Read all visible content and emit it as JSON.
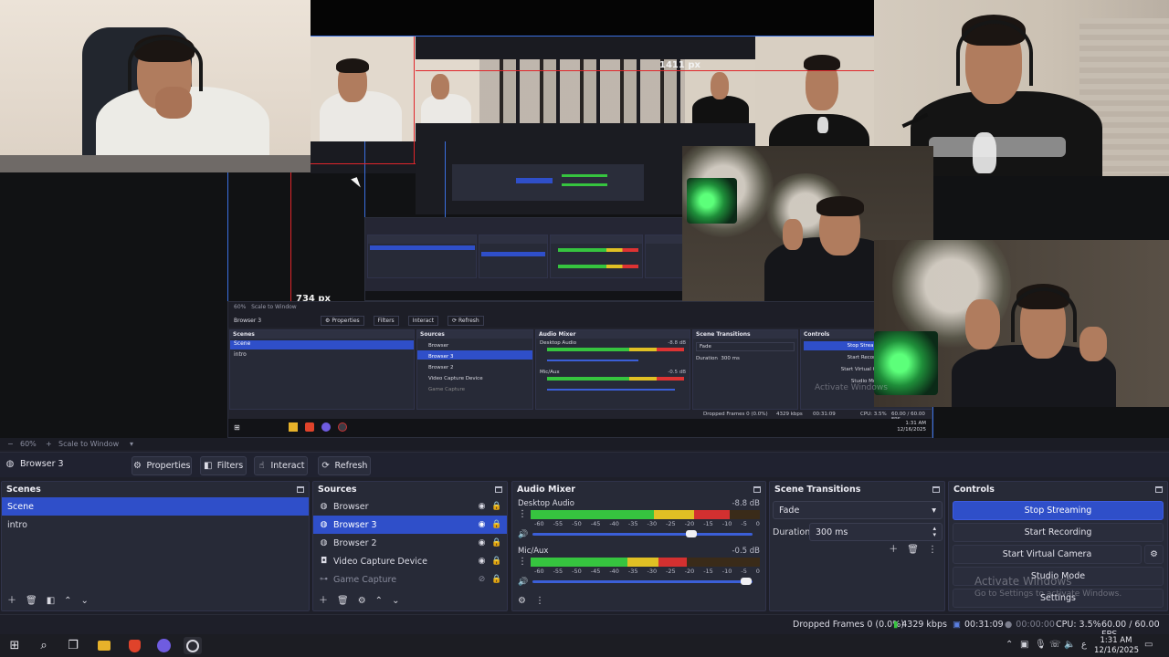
{
  "preview": {
    "labels": {
      "h_px": "1411 px",
      "v_px": "734 px"
    },
    "nested_window": {
      "zoom": "60%",
      "scale_label": "Scale to Window",
      "source": "Browser 3",
      "buttons": [
        "Properties",
        "Filters",
        "Interact",
        "Refresh"
      ],
      "docks": [
        "Scenes",
        "Sources",
        "Audio Mixer",
        "Scene Transitions",
        "Controls"
      ],
      "scenes": [
        "Scene",
        "intro"
      ],
      "sources": [
        "Browser",
        "Browser 3",
        "Browser 2",
        "Video Capture Device",
        "Game Capture"
      ],
      "mixer": [
        {
          "name": "Desktop Audio",
          "db": "-8.8 dB"
        },
        {
          "name": "Mic/Aux",
          "db": "-0.5 dB"
        }
      ],
      "transition": "Fade",
      "duration_label": "Duration",
      "duration": "300 ms",
      "controls": [
        "Stop Streaming",
        "Start Recording",
        "Start Virtual Camera",
        "Studio Mode"
      ],
      "status": [
        "Dropped Frames 0 (0.0%)",
        "4329 kbps",
        "00:31:09",
        "CPU: 3.5%",
        "60.00 / 60.00 FPS"
      ],
      "clock": [
        "1:31 AM",
        "12/16/2025"
      ]
    }
  },
  "zoombar": {
    "zoom": "60%",
    "scale": "Scale to Window"
  },
  "context": {
    "source_name": "Browser 3",
    "properties": "Properties",
    "filters": "Filters",
    "interact": "Interact",
    "refresh": "Refresh"
  },
  "scenes": {
    "title": "Scenes",
    "items": [
      "Scene",
      "intro"
    ],
    "selected": 0
  },
  "sources": {
    "title": "Sources",
    "items": [
      {
        "name": "Browser",
        "type": "globe-icon"
      },
      {
        "name": "Browser 3",
        "type": "globe-icon"
      },
      {
        "name": "Browser 2",
        "type": "globe-icon"
      },
      {
        "name": "Video Capture Device",
        "type": "camera-icon"
      },
      {
        "name": "Game Capture",
        "type": "gamepad-icon"
      }
    ],
    "selected": 1
  },
  "mixer": {
    "title": "Audio Mixer",
    "ticks": [
      "-60",
      "-55",
      "-50",
      "-45",
      "-40",
      "-35",
      "-30",
      "-25",
      "-20",
      "-15",
      "-10",
      "-5",
      "0"
    ],
    "channels": [
      {
        "name": "Desktop Audio",
        "db": "-8.8 dB",
        "level": 0.87,
        "volume": 0.72
      },
      {
        "name": "Mic/Aux",
        "db": "-0.5 dB",
        "level": 0.68,
        "volume": 0.97
      }
    ]
  },
  "transitions": {
    "title": "Scene Transitions",
    "selected": "Fade",
    "duration_label": "Duration",
    "duration": "300 ms"
  },
  "controls": {
    "title": "Controls",
    "stop_streaming": "Stop Streaming",
    "start_recording": "Start Recording",
    "start_virtual_camera": "Start Virtual Camera",
    "studio_mode": "Studio Mode",
    "settings": "Settings"
  },
  "watermark": {
    "line1": "Activate Windows",
    "line2": "Go to Settings to activate Windows."
  },
  "status": {
    "dropped": "Dropped Frames 0 (0.0%)",
    "bitrate": "4329 kbps",
    "stream_time": "00:31:09",
    "record_time": "00:00:00",
    "cpu": "CPU: 3.5%",
    "fps": "60.00 / 60.00 FPS"
  },
  "taskbar": {
    "time": "1:31 AM",
    "date": "12/16/2025"
  },
  "colors": {
    "accent": "#2f4fc9",
    "guide_red": "#e0262b",
    "guide_blue": "#3a6fe0",
    "panel": "#272a37"
  }
}
